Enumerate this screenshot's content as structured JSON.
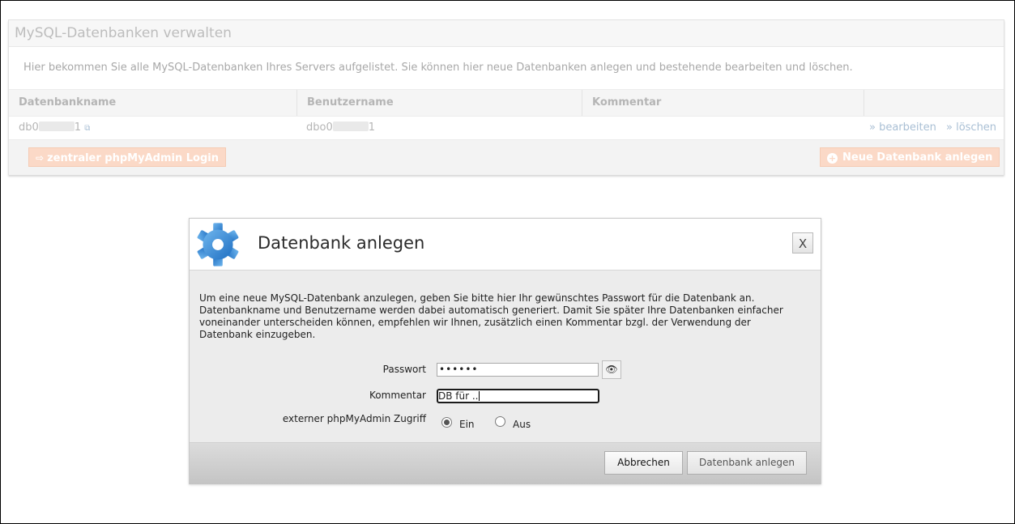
{
  "panel": {
    "title": "MySQL-Datenbanken verwalten",
    "description": "Hier bekommen Sie alle MySQL-Datenbanken Ihres Servers aufgelistet. Sie können hier neue Datenbanken anlegen und bestehende bearbeiten und löschen.",
    "columns": [
      "Datenbankname",
      "Benutzername",
      "Kommentar",
      ""
    ],
    "rows": [
      {
        "db_prefix": "db0",
        "db_suffix": "1",
        "user_prefix": "dbo0",
        "user_suffix": "1",
        "comment": "",
        "edit_link": "» bearbeiten",
        "delete_link": "» löschen"
      }
    ],
    "phpmyadmin_button": "zentraler phpMyAdmin Login",
    "new_db_button": "Neue Datenbank anlegen",
    "accent_color": "#fbd9c7"
  },
  "dialog": {
    "title": "Datenbank anlegen",
    "close_label": "X",
    "text": "Um eine neue MySQL-Datenbank anzulegen, geben Sie bitte hier Ihr gewünschtes Passwort für die Datenbank an. Datenbankname und Benutzername werden dabei automatisch generiert. Damit Sie später Ihre Datenbanken einfacher voneinander unterscheiden können, empfehlen wir Ihnen, zusätzlich einen Kommentar bzgl. der Verwendung der Datenbank einzugeben.",
    "password_label": "Passwort",
    "password_value": "••••••",
    "comment_label": "Kommentar",
    "comment_value": "DB für ..",
    "access_label": "externer phpMyAdmin Zugriff",
    "access_options": [
      "Ein",
      "Aus"
    ],
    "access_selected": "Ein",
    "cancel_button": "Abbrechen",
    "create_button": "Datenbank anlegen",
    "gear_color": "#3c8fd8"
  }
}
